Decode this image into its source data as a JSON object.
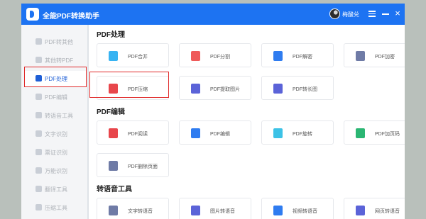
{
  "app": {
    "title": "全能PDF转换助手"
  },
  "user": {
    "name": "梅酸兑"
  },
  "sidebar": {
    "items": [
      {
        "label": "PDF转其他",
        "active": false
      },
      {
        "label": "其他转PDF",
        "active": false
      },
      {
        "label": "PDF处理",
        "active": true
      },
      {
        "label": "PDF编辑",
        "active": false
      },
      {
        "label": "转语音工具",
        "active": false
      },
      {
        "label": "文字识别",
        "active": false
      },
      {
        "label": "票证识别",
        "active": false
      },
      {
        "label": "万能识别",
        "active": false
      },
      {
        "label": "翻译工具",
        "active": false
      },
      {
        "label": "压缩工具",
        "active": false
      }
    ]
  },
  "sections": [
    {
      "title": "PDF处理",
      "tools": [
        {
          "label": "PDF合并",
          "icon": "pdf-merge-icon",
          "color": "#37b3f2"
        },
        {
          "label": "PDF分割",
          "icon": "pdf-split-icon",
          "color": "#ef5a5a"
        },
        {
          "label": "PDF解密",
          "icon": "pdf-unlock-icon",
          "color": "#2f7cf0"
        },
        {
          "label": "PDF加密",
          "icon": "pdf-lock-icon",
          "color": "#6f7ba6"
        },
        {
          "label": "PDF压缩",
          "icon": "pdf-compress-icon",
          "color": "#e8464b"
        },
        {
          "label": "PDF提取图片",
          "icon": "pdf-extract-image-icon",
          "color": "#5b63d8"
        },
        {
          "label": "PDF转长图",
          "icon": "pdf-long-image-icon",
          "color": "#5b63d8"
        }
      ]
    },
    {
      "title": "PDF编辑",
      "tools": [
        {
          "label": "PDF阅读",
          "icon": "pdf-read-icon",
          "color": "#e8464b"
        },
        {
          "label": "PDF编辑",
          "icon": "pdf-edit-icon",
          "color": "#2f7cf0"
        },
        {
          "label": "PDF旋转",
          "icon": "pdf-rotate-icon",
          "color": "#3cc2e6"
        },
        {
          "label": "PDF加页码",
          "icon": "pdf-page-number-icon",
          "color": "#2bb673"
        },
        {
          "label": "PDF删除页面",
          "icon": "pdf-delete-page-icon",
          "color": "#6f7ba6"
        }
      ]
    },
    {
      "title": "转语音工具",
      "tools": [
        {
          "label": "文字转语音",
          "icon": "text-to-speech-icon",
          "color": "#6f7ba6"
        },
        {
          "label": "图片转语音",
          "icon": "image-to-speech-icon",
          "color": "#5b63d8"
        },
        {
          "label": "视频转语音",
          "icon": "video-to-speech-icon",
          "color": "#2f7cf0"
        },
        {
          "label": "网页转语音",
          "icon": "webpage-to-speech-icon",
          "color": "#5b63d8"
        }
      ]
    }
  ]
}
